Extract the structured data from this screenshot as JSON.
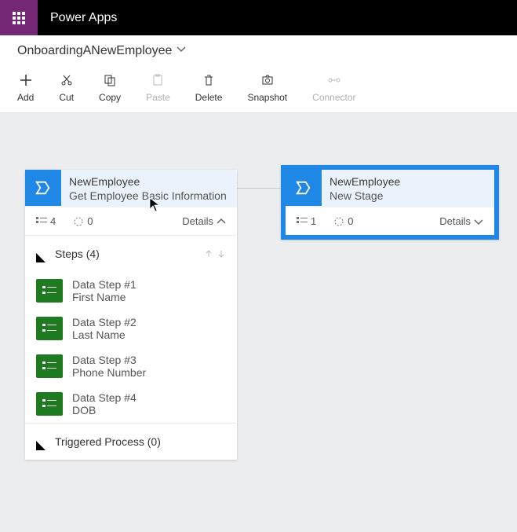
{
  "header": {
    "app_title": "Power Apps"
  },
  "breadcrumb": {
    "flow_name": "OnboardingANewEmployee"
  },
  "toolbar": {
    "add": "Add",
    "cut": "Cut",
    "copy": "Copy",
    "paste": "Paste",
    "delete": "Delete",
    "snapshot": "Snapshot",
    "connector": "Connector"
  },
  "stages": {
    "left": {
      "entity": "NewEmployee",
      "name": "Get Employee Basic Information",
      "step_count": "4",
      "trigger_count": "0",
      "details_label": "Details",
      "steps_header": "Steps (4)",
      "steps": [
        {
          "title": "Data Step #1",
          "field": "First Name"
        },
        {
          "title": "Data Step #2",
          "field": "Last Name"
        },
        {
          "title": "Data Step #3",
          "field": "Phone Number"
        },
        {
          "title": "Data Step #4",
          "field": "DOB"
        }
      ],
      "triggered_header": "Triggered Process (0)"
    },
    "right": {
      "entity": "NewEmployee",
      "name": "New Stage",
      "step_count": "1",
      "trigger_count": "0",
      "details_label": "Details"
    }
  }
}
